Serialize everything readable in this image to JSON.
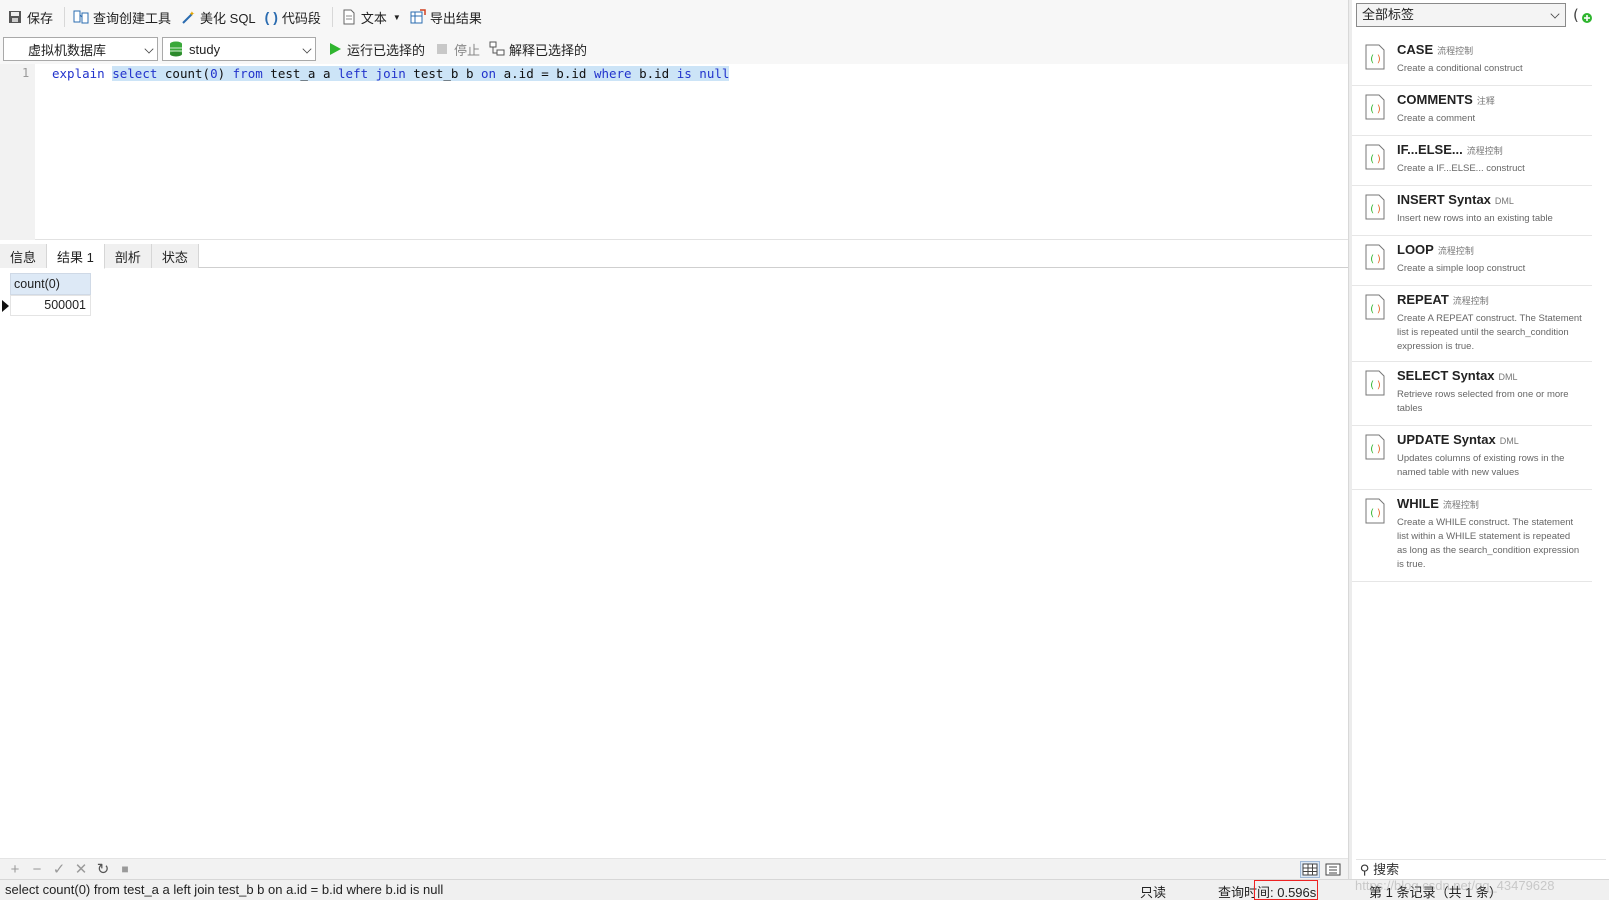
{
  "toolbar": {
    "save": "保存",
    "query_builder": "查询创建工具",
    "beautify": "美化 SQL",
    "snippets": "代码段",
    "text": "文本",
    "export": "导出结果"
  },
  "toolbar2": {
    "connection": "虚拟机数据库",
    "database": "study",
    "run": "运行已选择的",
    "stop": "停止",
    "explain": "解释已选择的"
  },
  "editor": {
    "line_number": "1",
    "code_tokens": [
      {
        "t": "explain",
        "c": "kw",
        "sel": false
      },
      {
        "t": " ",
        "c": "",
        "sel": false
      },
      {
        "t": "select",
        "c": "kw",
        "sel": true
      },
      {
        "t": " count(",
        "c": "ident",
        "sel": true
      },
      {
        "t": "0",
        "c": "kw",
        "sel": true
      },
      {
        "t": ") ",
        "c": "ident",
        "sel": true
      },
      {
        "t": "from",
        "c": "kw",
        "sel": true
      },
      {
        "t": " test_a a ",
        "c": "ident",
        "sel": true
      },
      {
        "t": "left join",
        "c": "kw",
        "sel": true
      },
      {
        "t": " test_b b ",
        "c": "ident",
        "sel": true
      },
      {
        "t": "on",
        "c": "kw",
        "sel": true
      },
      {
        "t": " a.id = b.id ",
        "c": "ident",
        "sel": true
      },
      {
        "t": "where",
        "c": "kw",
        "sel": true
      },
      {
        "t": " b.id ",
        "c": "ident",
        "sel": true
      },
      {
        "t": "is null",
        "c": "kw",
        "sel": true
      }
    ]
  },
  "tabs": [
    "信息",
    "结果 1",
    "剖析",
    "状态"
  ],
  "active_tab": "结果 1",
  "result": {
    "column": "count(0)",
    "value": "500001"
  },
  "status": {
    "sql": "select count(0) from test_a a left join test_b b on a.id = b.id where b.id is null",
    "mode": "只读",
    "time_label": "查询时间: 0.596s",
    "records": "第 1 条记录（共 1 条）",
    "watermark": "https://blog.csdn.net/qq_43479628"
  },
  "sidebar": {
    "tag_filter": "全部标签",
    "search": "搜索",
    "snippets": [
      {
        "title": "CASE",
        "tag": "流程控制",
        "desc": "Create a conditional construct"
      },
      {
        "title": "COMMENTS",
        "tag": "注释",
        "desc": "Create a comment"
      },
      {
        "title": "IF...ELSE...",
        "tag": "流程控制",
        "desc": "Create a IF...ELSE... construct"
      },
      {
        "title": "INSERT Syntax",
        "tag": "DML",
        "desc": "Insert new rows into an existing table"
      },
      {
        "title": "LOOP",
        "tag": "流程控制",
        "desc": "Create a simple loop construct"
      },
      {
        "title": "REPEAT",
        "tag": "流程控制",
        "desc": "Create A REPEAT construct. The Statement list is repeated until the search_condition expression is true."
      },
      {
        "title": "SELECT Syntax",
        "tag": "DML",
        "desc": "Retrieve rows selected from one or more tables"
      },
      {
        "title": "UPDATE Syntax",
        "tag": "DML",
        "desc": "Updates columns of existing rows in the named table with new values"
      },
      {
        "title": "WHILE",
        "tag": "流程控制",
        "desc": "Create a WHILE construct. The statement list within a WHILE statement is repeated as long as the search_condition expression is true."
      }
    ]
  }
}
